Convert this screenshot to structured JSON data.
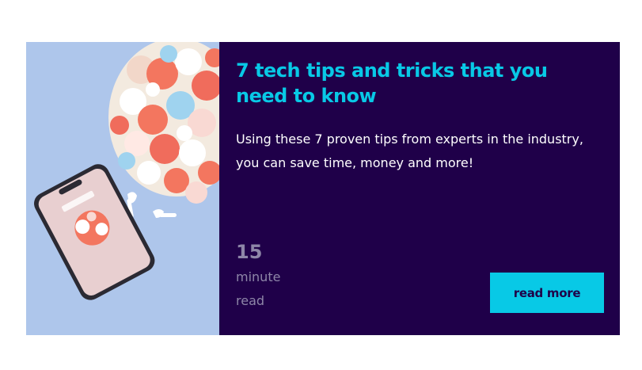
{
  "article": {
    "title": "7 tech tips and tricks that you need to know",
    "excerpt": "Using these 7 proven tips from experts in the industry, you can save time, money and more!",
    "read_time": {
      "number": "15",
      "unit": "minute read"
    },
    "read_more_label": "read more",
    "image_alt": "Phone and earbuds next to a bouquet of flowers"
  },
  "colors": {
    "card_background": "#1f0049",
    "accent": "#08c9e6",
    "muted_text": "#8e86a8",
    "photo_background": "#a9c2e8"
  },
  "icons": {
    "image": "photo-phone-flowers"
  }
}
